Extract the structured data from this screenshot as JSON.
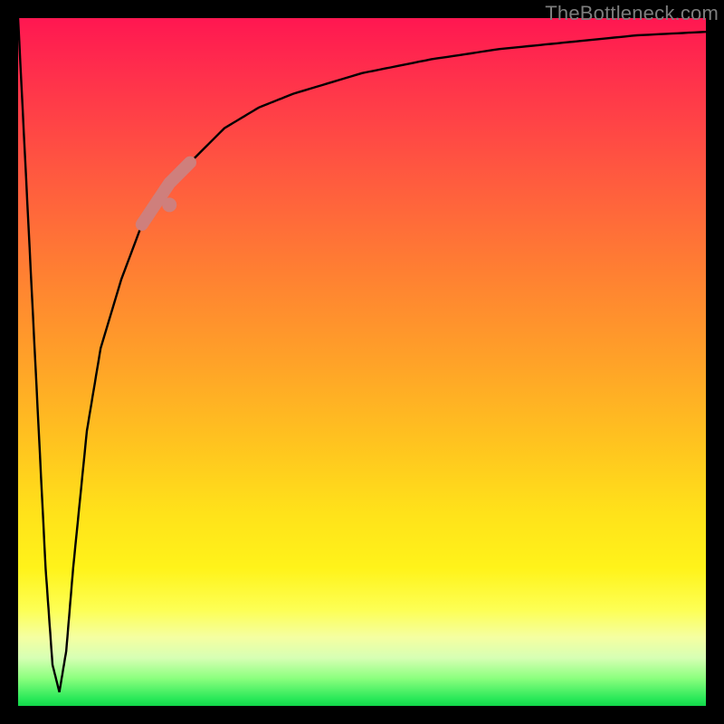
{
  "watermark": {
    "text": "TheBottleneck.com"
  },
  "colors": {
    "curve": "#000000",
    "accent_marker": "#cf7f7c",
    "frame": "#000000"
  },
  "chart_data": {
    "type": "line",
    "title": "",
    "xlabel": "",
    "ylabel": "",
    "xlim": [
      0,
      100
    ],
    "ylim": [
      0,
      100
    ],
    "grid": false,
    "legend": false,
    "notes": "Chart has no visible axis tick labels; values are estimated from pixel positions. Y encodes bottleneck percentage where 0 is the green (good) band at the bottom and 100 is the red (bad) band at the top. The curve plunges from ~100 at x≈0 to a narrow minimum near x≈6 (y≈2), then rises steeply and asymptotically approaches ~98–99 as x→100. A thick salmon highlight segment sits on the rising limb roughly between x≈18 and x≈25.",
    "series": [
      {
        "name": "bottleneck-curve",
        "x": [
          0,
          2,
          4,
          5,
          6,
          7,
          8,
          10,
          12,
          15,
          18,
          22,
          26,
          30,
          35,
          40,
          50,
          60,
          70,
          80,
          90,
          100
        ],
        "y": [
          100,
          60,
          20,
          6,
          2,
          8,
          20,
          40,
          52,
          62,
          70,
          76,
          80,
          84,
          87,
          89,
          92,
          94,
          95.5,
          96.5,
          97.5,
          98
        ]
      }
    ],
    "annotations": [
      {
        "name": "highlight-segment",
        "kind": "thick-marker-on-curve",
        "color": "#cf7f7c",
        "x_range": [
          18,
          25
        ],
        "y_range_est": [
          58,
          73
        ]
      },
      {
        "name": "highlight-dot",
        "kind": "small-marker-on-curve",
        "color": "#cf7f7c",
        "x": 22,
        "y_est": 60
      }
    ],
    "color_bands_y": [
      {
        "y_from": 96,
        "y_to": 100,
        "meaning": "worst",
        "color_hint": "#ff1751"
      },
      {
        "y_from": 60,
        "y_to": 96,
        "meaning": "bad",
        "color_hint": "#ff7d33"
      },
      {
        "y_from": 20,
        "y_to": 60,
        "meaning": "warn",
        "color_hint": "#ffe21a"
      },
      {
        "y_from": 4,
        "y_to": 20,
        "meaning": "ok",
        "color_hint": "#fdff54"
      },
      {
        "y_from": 0,
        "y_to": 4,
        "meaning": "best",
        "color_hint": "#28e858"
      }
    ]
  }
}
